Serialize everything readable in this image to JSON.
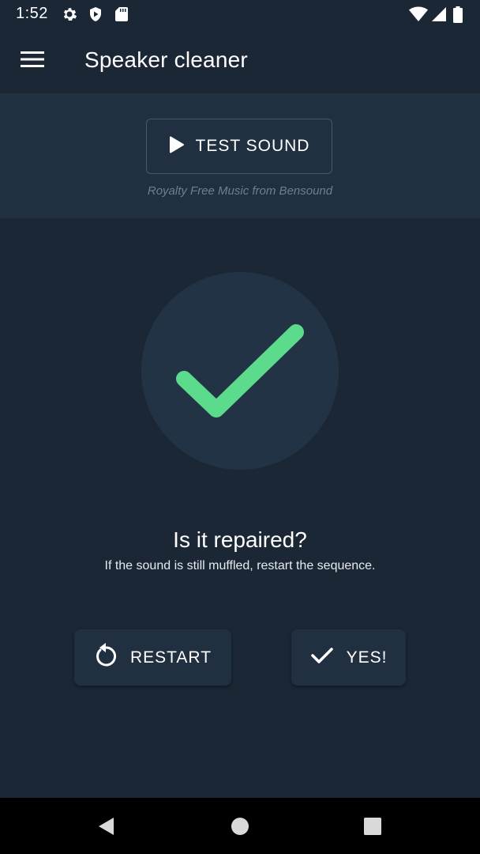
{
  "status_bar": {
    "time": "1:52",
    "left_icons": [
      "gear-icon",
      "shield-play-icon",
      "sd-card-icon"
    ],
    "right_icons": [
      "wifi-icon",
      "cell-signal-icon",
      "battery-icon"
    ]
  },
  "app_bar": {
    "title": "Speaker cleaner",
    "menu_icon": "hamburger-menu-icon"
  },
  "test_panel": {
    "button_label": "TEST SOUND",
    "button_icon": "play-icon",
    "credit": "Royalty Free Music from Bensound"
  },
  "result": {
    "icon": "checkmark-icon",
    "check_color": "#5ddb8c",
    "question": "Is it repaired?",
    "hint": "If the sound is still muffled, restart the sequence."
  },
  "actions": {
    "restart_label": "RESTART",
    "restart_icon": "restart-icon",
    "yes_label": "YES!",
    "yes_icon": "check-icon"
  },
  "nav_bar": {
    "buttons": [
      "back-icon",
      "home-icon",
      "recents-icon"
    ]
  },
  "colors": {
    "background": "#1b2735",
    "panel": "#213040",
    "accent": "#5ddb8c"
  }
}
